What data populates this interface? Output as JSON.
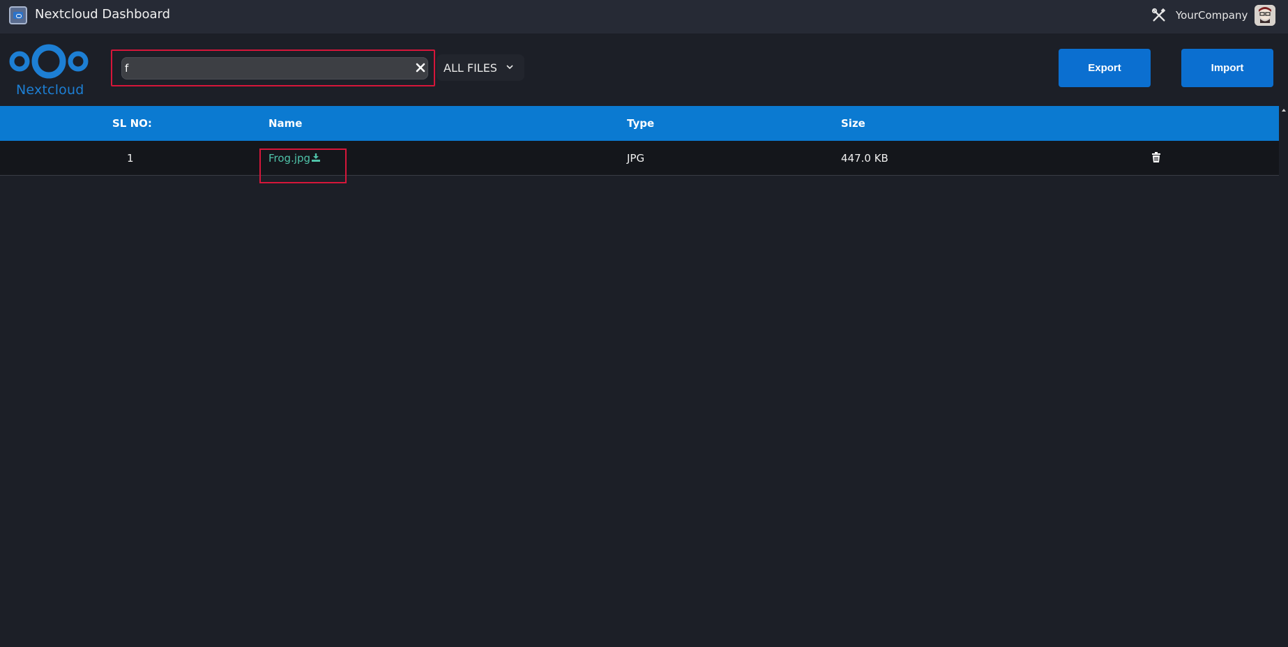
{
  "topbar": {
    "app_title": "Nextcloud Dashboard",
    "company": "YourCompany",
    "icons": [
      "app-icon",
      "tools-icon",
      "avatar"
    ]
  },
  "header": {
    "logo_text": "Nextcloud",
    "search": {
      "value": "f",
      "placeholder": ""
    },
    "filter": {
      "selected": "ALL FILES"
    },
    "buttons": {
      "export_label": "Export",
      "import_label": "Import"
    }
  },
  "table": {
    "columns": [
      "SL NO:",
      "Name",
      "Type",
      "Size"
    ],
    "rows": [
      {
        "sl_no": "1",
        "name": "Frog.jpg",
        "type": "JPG",
        "size": "447.0 KB"
      }
    ]
  },
  "colors": {
    "accent": "#0b6fd0",
    "table_header": "#0b7ad1",
    "link": "#4fc2a8",
    "highlight": "#d6163a",
    "background": "#1c1f27"
  }
}
